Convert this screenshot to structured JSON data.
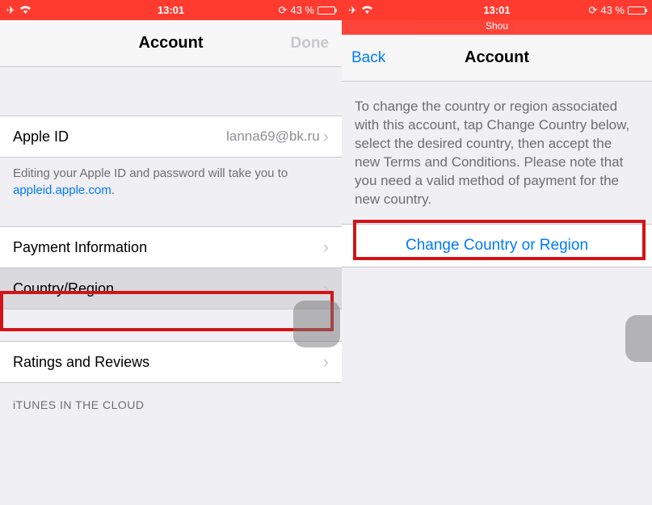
{
  "left": {
    "status": {
      "time": "13:01",
      "battery": "43 %"
    },
    "nav": {
      "title": "Account",
      "done": "Done"
    },
    "appleId": {
      "label": "Apple ID",
      "value": "lanna69@bk.ru"
    },
    "footerPrefix": "Editing your Apple ID and password will take you to ",
    "footerLink": "appleid.apple.com",
    "footerSuffix": ".",
    "payment": "Payment Information",
    "country": "Country/Region",
    "ratings": "Ratings and Reviews",
    "itunesHeader": "iTUNES IN THE CLOUD"
  },
  "right": {
    "status": {
      "time": "13:01",
      "battery": "43 %",
      "subtitle": "Shou"
    },
    "nav": {
      "back": "Back",
      "title": "Account"
    },
    "description": "To change the country or region associated with this account, tap Change Country below, select the desired country, then accept the new Terms and Conditions. Please note that you need a valid method of payment for the new country.",
    "action": "Change Country or Region"
  }
}
